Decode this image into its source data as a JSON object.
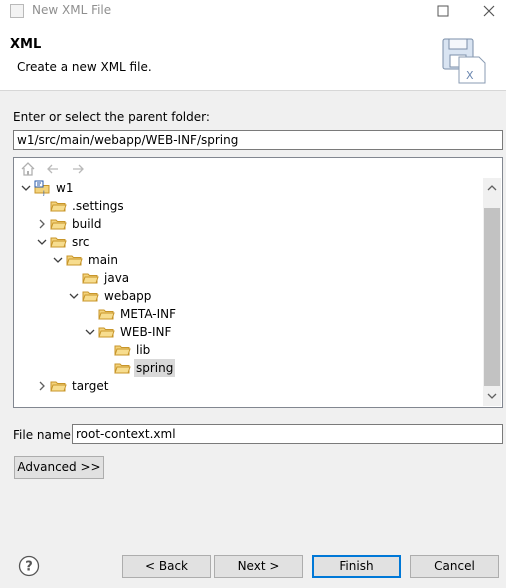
{
  "window": {
    "title": "New XML File"
  },
  "banner": {
    "title": "XML",
    "description": "Create a new XML file."
  },
  "parent_folder": {
    "label": "Enter or select the parent folder:",
    "value": "w1/src/main/webapp/WEB-INF/spring"
  },
  "tree": {
    "project": "w1",
    "items": [
      {
        "label": ".settings"
      },
      {
        "label": "build"
      },
      {
        "label": "src"
      },
      {
        "label": "main"
      },
      {
        "label": "java"
      },
      {
        "label": "webapp"
      },
      {
        "label": "META-INF"
      },
      {
        "label": "WEB-INF"
      },
      {
        "label": "lib"
      },
      {
        "label": "spring"
      },
      {
        "label": "target"
      }
    ],
    "selected": "spring"
  },
  "file_name": {
    "label": "File name:",
    "value": "root-context.xml"
  },
  "buttons": {
    "advanced": "Advanced >>",
    "back": "< Back",
    "next": "Next >",
    "finish": "Finish",
    "cancel": "Cancel"
  },
  "colors": {
    "accent": "#0078d7",
    "folder": "#e8b94a",
    "selection": "#d9d9d9"
  }
}
